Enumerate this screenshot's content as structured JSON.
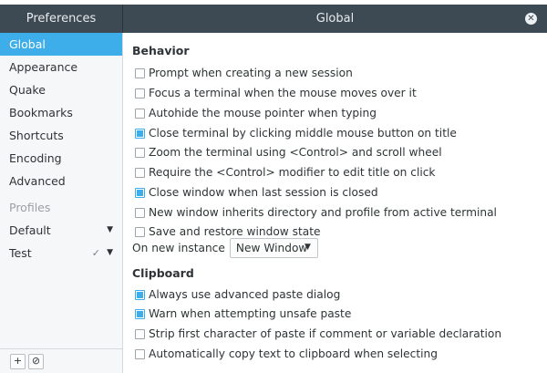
{
  "sidebar": {
    "title": "Preferences",
    "nav": [
      {
        "label": "Global",
        "active": true
      },
      {
        "label": "Appearance",
        "active": false
      },
      {
        "label": "Quake",
        "active": false
      },
      {
        "label": "Bookmarks",
        "active": false
      },
      {
        "label": "Shortcuts",
        "active": false
      },
      {
        "label": "Encoding",
        "active": false
      },
      {
        "label": "Advanced",
        "active": false
      }
    ],
    "profiles_label": "Profiles",
    "profiles": [
      {
        "name": "Default",
        "is_default": false
      },
      {
        "name": "Test",
        "is_default": true
      }
    ],
    "footer": {
      "add_icon": "plus-icon",
      "remove_icon": "no-entry-icon"
    }
  },
  "main": {
    "title": "Global",
    "close_icon": "close-icon",
    "behavior": {
      "title": "Behavior",
      "options": [
        {
          "label": "Prompt when creating a new session",
          "checked": false
        },
        {
          "label": "Focus a terminal when the mouse moves over it",
          "checked": false
        },
        {
          "label": "Autohide the mouse pointer when typing",
          "checked": false
        },
        {
          "label": "Close terminal by clicking middle mouse button on title",
          "checked": true
        },
        {
          "label": "Zoom the terminal using <Control> and scroll wheel",
          "checked": false
        },
        {
          "label": "Require the <Control> modifier to edit title on click",
          "checked": false
        },
        {
          "label": "Close window when last session is closed",
          "checked": true
        },
        {
          "label": "New window inherits directory and profile from active terminal",
          "checked": false
        },
        {
          "label": "Save and restore window state",
          "checked": false
        }
      ]
    },
    "on_new_instance": {
      "label": "On new instance",
      "value": "New Window"
    },
    "clipboard": {
      "title": "Clipboard",
      "options": [
        {
          "label": "Always use advanced paste dialog",
          "checked": true
        },
        {
          "label": "Warn when attempting unsafe paste",
          "checked": true
        },
        {
          "label": "Strip first character of paste if comment or variable declaration",
          "checked": false
        },
        {
          "label": "Automatically copy text to clipboard when selecting",
          "checked": false
        }
      ]
    }
  },
  "colors": {
    "accent": "#3daee9",
    "header": "#3d4a53"
  }
}
